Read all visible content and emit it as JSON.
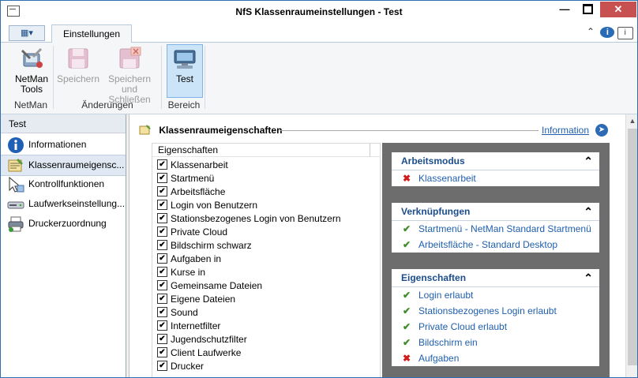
{
  "window": {
    "title": "NfS Klassenraumeinstellungen - Test"
  },
  "ribbon": {
    "tab": "Einstellungen",
    "buttons": {
      "netman": "NetMan\nTools",
      "speichern": "Speichern",
      "speichern_schliessen": "Speichern\nund Schließen",
      "test": "Test"
    },
    "groups": {
      "netman": "NetMan",
      "aenderungen": "Änderungen",
      "bereich": "Bereich"
    }
  },
  "nav": {
    "header": "Test",
    "items": [
      {
        "label": "Informationen",
        "icon": "info-icon"
      },
      {
        "label": "Klassenraumeigensc...",
        "icon": "classroom-icon"
      },
      {
        "label": "Kontrollfunktionen",
        "icon": "cursor-icon"
      },
      {
        "label": "Laufwerkseinstellung...",
        "icon": "drive-icon"
      },
      {
        "label": "Druckerzuordnung",
        "icon": "printer-icon"
      }
    ]
  },
  "main": {
    "title": "Klassenraumeigenschaften",
    "info_link": "Information",
    "list_header": "Eigenschaften",
    "properties": [
      "Klassenarbeit",
      "Startmenü",
      "Arbeitsfläche",
      "Login von Benutzern",
      "Stationsbezogenes Login von Benutzern",
      "Private Cloud",
      "Bildschirm schwarz",
      "Aufgaben in",
      "Kurse in",
      "Gemeinsame Dateien",
      "Eigene Dateien",
      "Sound",
      "Internetfilter",
      "Jugendschutzfilter",
      "Client Laufwerke",
      "Drucker"
    ]
  },
  "summary": {
    "cards": [
      {
        "title": "Arbeitsmodus",
        "items": [
          {
            "status": "no",
            "text": "Klassenarbeit"
          }
        ]
      },
      {
        "title": "Verknüpfungen",
        "items": [
          {
            "status": "ok",
            "text": "Startmenü - NetMan Standard Startmenü"
          },
          {
            "status": "ok",
            "text": "Arbeitsfläche - Standard Desktop"
          }
        ]
      },
      {
        "title": "Eigenschaften",
        "items": [
          {
            "status": "ok",
            "text": "Login erlaubt"
          },
          {
            "status": "ok",
            "text": "Stationsbezogenes Login erlaubt"
          },
          {
            "status": "ok",
            "text": "Private Cloud erlaubt"
          },
          {
            "status": "ok",
            "text": "Bildschirm ein"
          },
          {
            "status": "no",
            "text": "Aufgaben"
          }
        ]
      }
    ]
  }
}
